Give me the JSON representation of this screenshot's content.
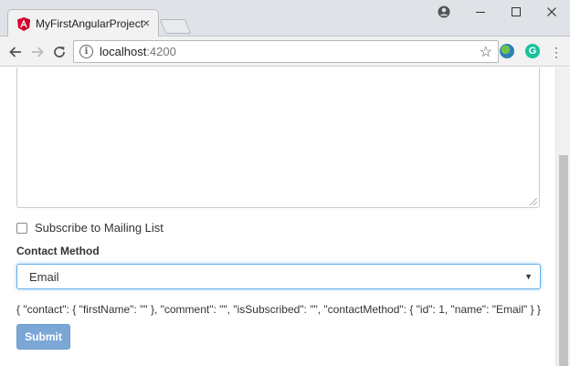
{
  "browser": {
    "tab_title": "MyFirstAngularProject",
    "tab_close": "×",
    "url_host": "localhost",
    "url_port": ":4200",
    "icons": {
      "back": "arrow-left-icon",
      "forward": "arrow-right-icon",
      "reload": "reload-icon",
      "info": "info-icon",
      "star": "star-icon",
      "extension_1": "globe-extension-icon",
      "extension_2": "grammarly-icon",
      "menu": "kebab-menu-icon"
    }
  },
  "form": {
    "subscribe_label": "Subscribe to Mailing List",
    "contact_method_label": "Contact Method",
    "contact_method_value": "Email",
    "model_json": "{ \"contact\": { \"firstName\": \"\" }, \"comment\": \"\", \"isSubscribed\": \"\", \"contactMethod\": { \"id\": 1, \"name\": \"Email\" } }",
    "submit_label": "Submit"
  },
  "colors": {
    "submit_bg": "#7ba7d7",
    "focus_border": "#66afe9",
    "angular_red": "#dd0031"
  }
}
